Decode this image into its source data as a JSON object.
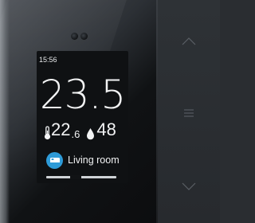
{
  "status_bar": {
    "time": "15:56"
  },
  "climate": {
    "set_temperature": "23.5",
    "room_temperature_whole": "22",
    "room_temperature_decimal": ".6",
    "humidity": "48"
  },
  "room": {
    "name": "Living room",
    "icon": "bed-icon"
  },
  "progress": {
    "position_fraction": 0.4
  },
  "buttons": {
    "up": "chevron-up-icon",
    "menu": "menu-icon",
    "down": "chevron-down-icon"
  },
  "colors": {
    "screen_background": "#0f1113",
    "text": "#f2f3f4",
    "room_icon_accent": "#2e9bd8"
  }
}
